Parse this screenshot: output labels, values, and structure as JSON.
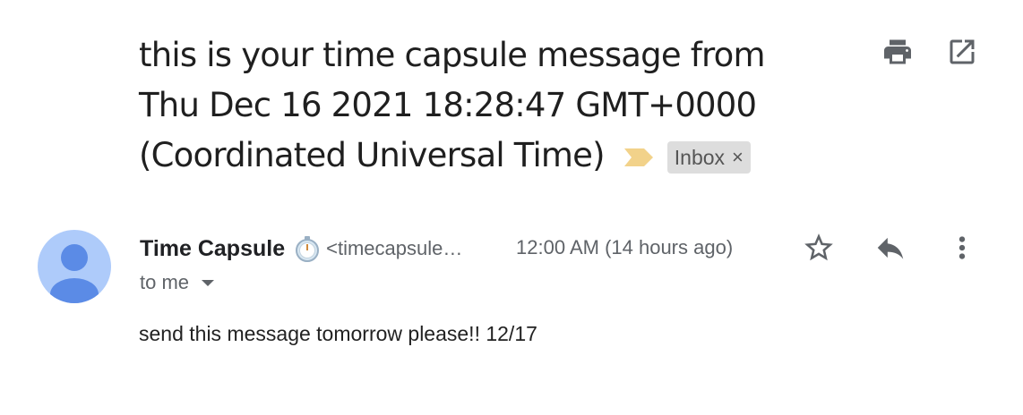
{
  "subject": {
    "line1": "this is your time capsule message from",
    "line2": "Thu Dec 16 2021 18:28:47 GMT+0000",
    "line3": "(Coordinated Universal Time)"
  },
  "label": {
    "text": "Inbox",
    "close_glyph": "×"
  },
  "toolbar": {
    "print_icon": "print-icon",
    "open_new_window_icon": "open-in-new-window-icon"
  },
  "sender": {
    "name": "Time Capsule",
    "email_truncated": "<timecapsule…",
    "badge_icon": "stopwatch-icon"
  },
  "time": "12:00 AM (14 hours ago)",
  "recipient": {
    "text": "to me",
    "dropdown_icon": "caret-down-icon"
  },
  "actions": {
    "star_icon": "star-outline-icon",
    "reply_icon": "reply-icon",
    "more_icon": "more-vert-icon"
  },
  "body": "send this message tomorrow please!! 12/17",
  "colors": {
    "importance_marker": "#f2d28a",
    "avatar_bg": "#aecbfa",
    "avatar_fg": "#5b8be6",
    "label_chip_bg": "#dddddd"
  }
}
